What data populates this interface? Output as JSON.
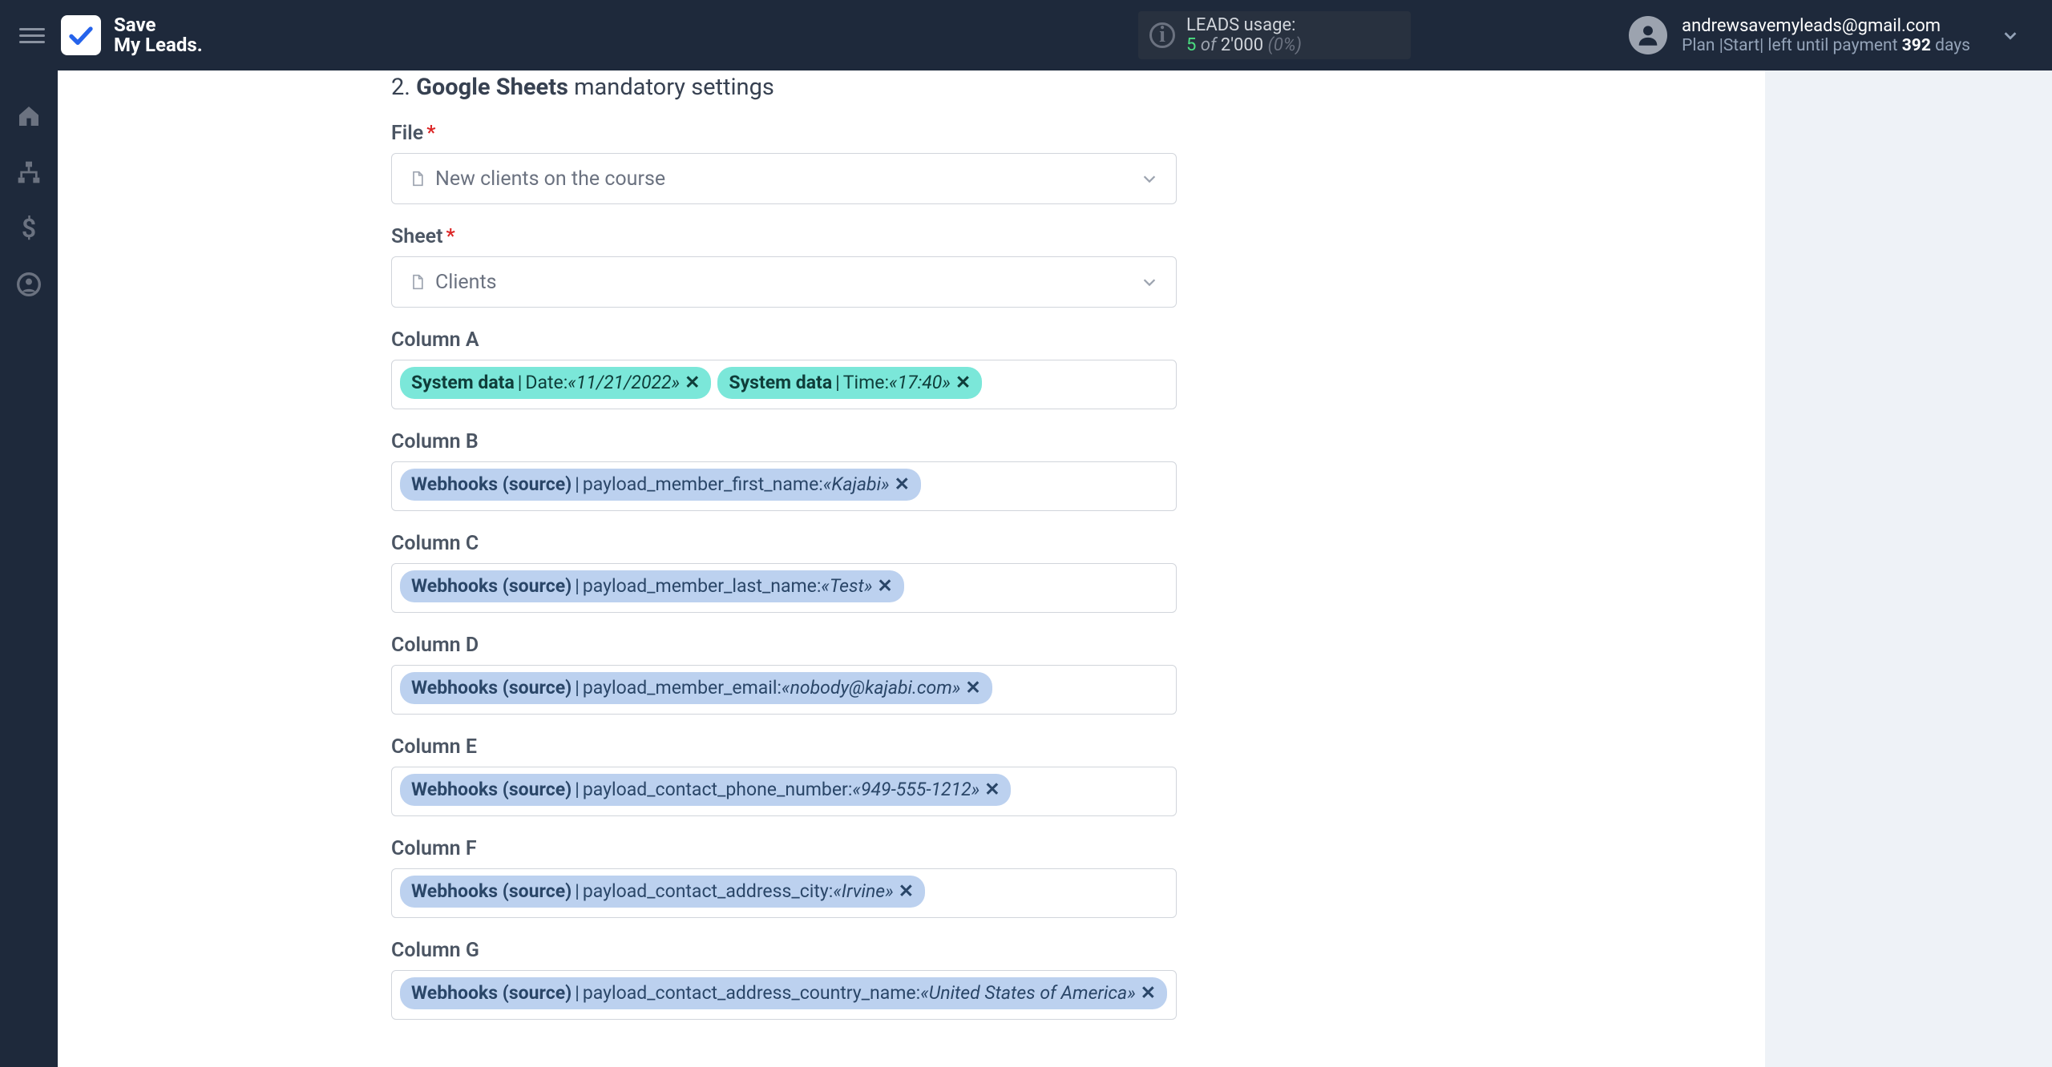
{
  "brand": {
    "line1": "Save",
    "line2": "My Leads."
  },
  "usage": {
    "title": "LEADS usage:",
    "used": "5",
    "of_word": "of",
    "limit": "2'000",
    "pct": "(0%)"
  },
  "account": {
    "email": "andrewsavemyleads@gmail.com",
    "plan_prefix": "Plan |Start| left until payment ",
    "plan_days": "392",
    "plan_suffix": " days"
  },
  "section": {
    "num": "2.",
    "strong": "Google Sheets",
    "rest": " mandatory settings"
  },
  "file": {
    "label": "File",
    "value": "New clients on the course"
  },
  "sheet": {
    "label": "Sheet",
    "value": "Clients"
  },
  "columns": [
    {
      "label": "Column A",
      "tags": [
        {
          "type": "system",
          "src": "System data",
          "field": "Date:",
          "val": "«11/21/2022»"
        },
        {
          "type": "system",
          "src": "System data",
          "field": "Time:",
          "val": "«17:40»"
        }
      ]
    },
    {
      "label": "Column B",
      "tags": [
        {
          "type": "webhook",
          "src": "Webhooks (source)",
          "field": "payload_member_first_name:",
          "val": "«Kajabi»"
        }
      ]
    },
    {
      "label": "Column C",
      "tags": [
        {
          "type": "webhook",
          "src": "Webhooks (source)",
          "field": "payload_member_last_name:",
          "val": "«Test»"
        }
      ]
    },
    {
      "label": "Column D",
      "tags": [
        {
          "type": "webhook",
          "src": "Webhooks (source)",
          "field": "payload_member_email:",
          "val": "«nobody@kajabi.com»"
        }
      ]
    },
    {
      "label": "Column E",
      "tags": [
        {
          "type": "webhook",
          "src": "Webhooks (source)",
          "field": "payload_contact_phone_number:",
          "val": "«949-555-1212»"
        }
      ]
    },
    {
      "label": "Column F",
      "tags": [
        {
          "type": "webhook",
          "src": "Webhooks (source)",
          "field": "payload_contact_address_city:",
          "val": "«Irvine»"
        }
      ]
    },
    {
      "label": "Column G",
      "tags": [
        {
          "type": "webhook",
          "src": "Webhooks (source)",
          "field": "payload_contact_address_country_name:",
          "val": "«United States of America»"
        }
      ]
    }
  ]
}
